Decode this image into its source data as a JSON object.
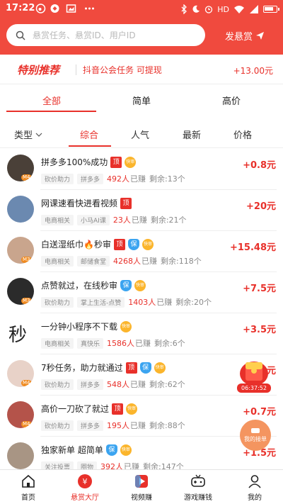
{
  "status_bar": {
    "time": "17:22",
    "right_text": "HD"
  },
  "search": {
    "placeholder": "悬赏任务、悬赏ID、用户ID",
    "publish_label": "发悬赏"
  },
  "special": {
    "title": "特别推荐",
    "text": "抖音公会任务 可提现",
    "amount": "+13.00元"
  },
  "tabs": [
    {
      "label": "全部",
      "active": true
    },
    {
      "label": "简单",
      "active": false
    },
    {
      "label": "高价",
      "active": false
    }
  ],
  "filters": {
    "type_label": "类型",
    "items": [
      {
        "label": "综合",
        "active": true
      },
      {
        "label": "人气",
        "active": false
      },
      {
        "label": "最新",
        "active": false
      },
      {
        "label": "价格",
        "active": false
      }
    ]
  },
  "badges": {
    "ding": "顶",
    "bao": "保",
    "fast": "快审"
  },
  "tasks": [
    {
      "title": "拼多多100%成功",
      "ding": true,
      "bao": false,
      "fast": true,
      "tags": [
        "砍价助力",
        "拼多多"
      ],
      "earned_count": "492人",
      "earned_label": "已赚",
      "remain": "剩余:13个",
      "reward": "+0.8元",
      "avatar_color": "#4a4038",
      "avatar_tag": "M4"
    },
    {
      "title": "网课速看快进看视频",
      "ding": true,
      "bao": false,
      "fast": false,
      "tags": [
        "电商相关",
        "小马AI课"
      ],
      "earned_count": "23人",
      "earned_label": "已赚",
      "remain": "剩余:21个",
      "reward": "+20元",
      "avatar_color": "#6b89b0",
      "avatar_tag": ""
    },
    {
      "title": "白送湿纸巾🔥秒审",
      "ding": true,
      "bao": true,
      "fast": true,
      "tags": [
        "电商相关",
        "邮储食堂"
      ],
      "earned_count": "4268人",
      "earned_label": "已赚",
      "remain": "剩余:118个",
      "reward": "+15.48元",
      "avatar_color": "#c9a58d",
      "avatar_tag": "M3"
    },
    {
      "title": "点赞就过，在线秒审",
      "ding": false,
      "bao": true,
      "fast": true,
      "tags": [
        "砍价助力",
        "掌上生活-点赞"
      ],
      "earned_count": "1403人",
      "earned_label": "已赚",
      "remain": "剩余:20个",
      "reward": "+7.5元",
      "avatar_color": "#2b2b2b",
      "avatar_tag": "M3"
    },
    {
      "title": "一分钟小程序不下载",
      "ding": false,
      "bao": false,
      "fast": true,
      "tags": [
        "电商相关",
        "真快乐"
      ],
      "earned_count": "1586人",
      "earned_label": "已赚",
      "remain": "剩余:6个",
      "reward": "+3.5元",
      "avatar_color": "#ffffff",
      "avatar_tag": "",
      "avatar_text": "秒"
    },
    {
      "title": "7秒任务，助力就通过",
      "ding": true,
      "bao": true,
      "fast": true,
      "tags": [
        "砍价助力",
        "拼多多"
      ],
      "earned_count": "548人",
      "earned_label": "已赚",
      "remain": "剩余:62个",
      "reward": "+2元",
      "avatar_color": "#e8d2c8",
      "avatar_tag": "M4"
    },
    {
      "title": "高价一刀砍了就过",
      "ding": true,
      "bao": false,
      "fast": true,
      "tags": [
        "砍价助力",
        "拼多多"
      ],
      "earned_count": "195人",
      "earned_label": "已赚",
      "remain": "剩余:88个",
      "reward": "+0.7元",
      "avatar_color": "#b4534a",
      "avatar_tag": "M4"
    },
    {
      "title": "独家新单 超简单",
      "ding": false,
      "bao": true,
      "fast": true,
      "tags": [
        "关注投票",
        "圈物"
      ],
      "earned_count": "392人",
      "earned_label": "已赚",
      "remain": "剩余:147个",
      "reward": "+1.5元",
      "avatar_color": "#a89584",
      "avatar_tag": ""
    }
  ],
  "floating": {
    "timer": "06:37:52",
    "take_order": "我的接单"
  },
  "bottom_nav": [
    {
      "label": "首页",
      "icon": "home-icon",
      "active": false
    },
    {
      "label": "悬赏大厅",
      "icon": "reward-hall-icon",
      "active": true
    },
    {
      "label": "视频赚",
      "icon": "video-earn-icon",
      "active": false
    },
    {
      "label": "游戏赚钱",
      "icon": "game-icon",
      "active": false
    },
    {
      "label": "我的",
      "icon": "profile-icon",
      "active": false
    }
  ],
  "colors": {
    "brand_red": "#f04a3e",
    "accent_red": "#e8302a",
    "bao_blue": "#3ba4f0",
    "fast_yellow": "#fbb52c"
  }
}
